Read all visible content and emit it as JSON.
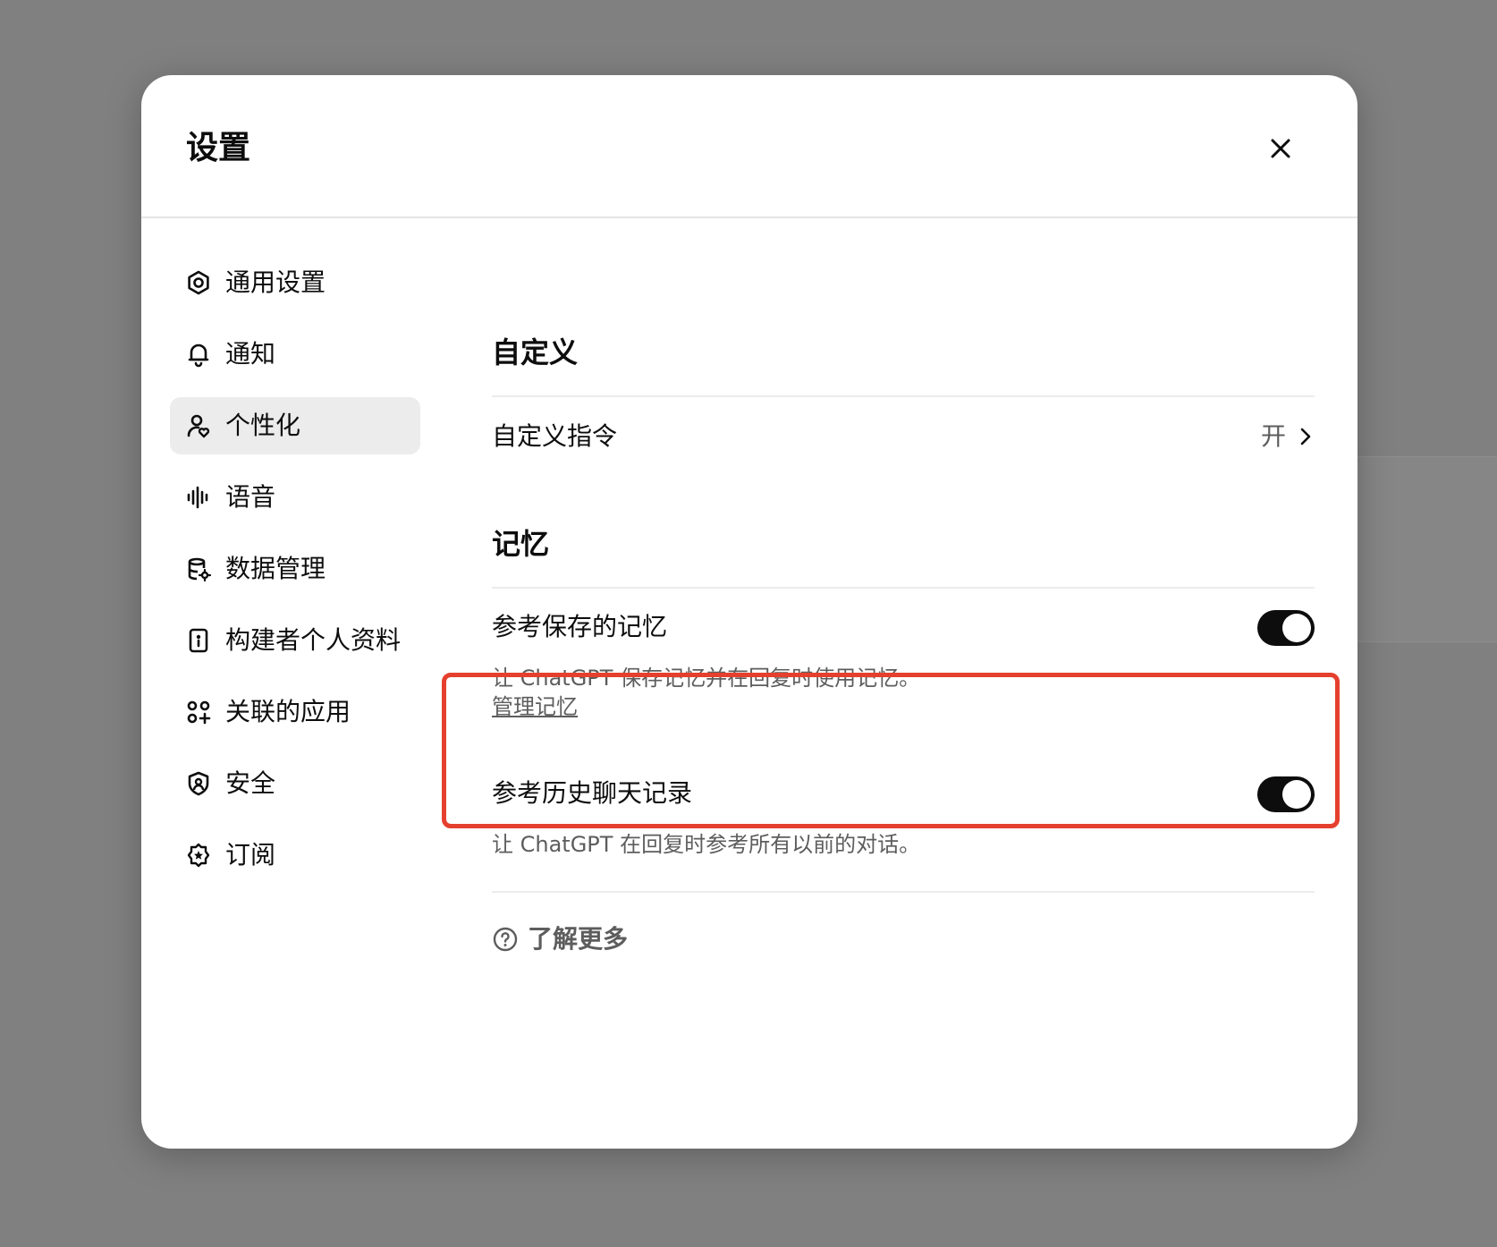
{
  "modal": {
    "title": "设置"
  },
  "sidebar": {
    "items": [
      {
        "label": "通用设置",
        "icon": "gear-icon"
      },
      {
        "label": "通知",
        "icon": "bell-icon"
      },
      {
        "label": "个性化",
        "icon": "person-heart-icon",
        "active": true
      },
      {
        "label": "语音",
        "icon": "waveform-icon"
      },
      {
        "label": "数据管理",
        "icon": "database-gear-icon"
      },
      {
        "label": "构建者个人资料",
        "icon": "id-badge-icon"
      },
      {
        "label": "关联的应用",
        "icon": "apps-grid-icon"
      },
      {
        "label": "安全",
        "icon": "shield-lock-icon"
      },
      {
        "label": "订阅",
        "icon": "star-badge-icon"
      }
    ]
  },
  "content": {
    "customize": {
      "title": "自定义",
      "instructions_label": "自定义指令",
      "instructions_value": "开"
    },
    "memory": {
      "title": "记忆",
      "saved": {
        "label": "参考保存的记忆",
        "description": "让 ChatGPT 保存记忆并在回复时使用记忆。",
        "link": "管理记忆",
        "enabled": true
      },
      "history": {
        "label": "参考历史聊天记录",
        "description": "让 ChatGPT 在回复时参考所有以前的对话。",
        "enabled": true
      },
      "learn_more": "了解更多"
    }
  },
  "colors": {
    "overlay": "#808080",
    "highlight": "#e5402e",
    "toggle_on": "#0d0d0d",
    "active_nav": "#ececec"
  }
}
